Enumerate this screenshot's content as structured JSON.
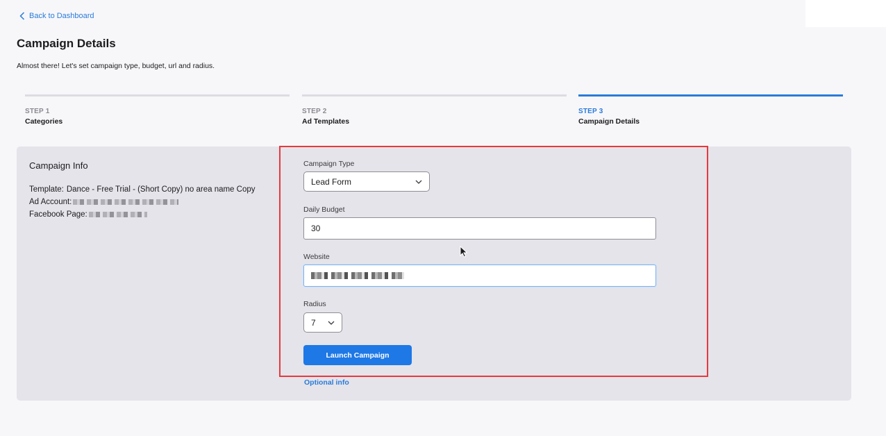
{
  "nav": {
    "back_label": "Back to Dashboard"
  },
  "header": {
    "title": "Campaign Details",
    "subtitle": "Almost there! Let's set campaign type, budget, url and radius."
  },
  "steps": [
    {
      "number": "STEP 1",
      "name": "Categories",
      "active": false
    },
    {
      "number": "STEP 2",
      "name": "Ad Templates",
      "active": false
    },
    {
      "number": "STEP 3",
      "name": "Campaign Details",
      "active": true
    }
  ],
  "campaign_info": {
    "title": "Campaign Info",
    "template_label": "Template:",
    "template_value": "Dance - Free Trial - (Short Copy) no area name Copy",
    "ad_account_label": "Ad Account:",
    "facebook_page_label": "Facebook Page:"
  },
  "form": {
    "campaign_type": {
      "label": "Campaign Type",
      "value": "Lead Form"
    },
    "daily_budget": {
      "label": "Daily Budget",
      "value": "30"
    },
    "website": {
      "label": "Website"
    },
    "radius": {
      "label": "Radius",
      "value": "7"
    },
    "launch_label": "Launch Campaign",
    "optional_label": "Optional info"
  },
  "colors": {
    "accent": "#1e78e6",
    "link": "#2a7bd8",
    "highlight": "#e8383d",
    "panel": "#e4e4ea"
  }
}
